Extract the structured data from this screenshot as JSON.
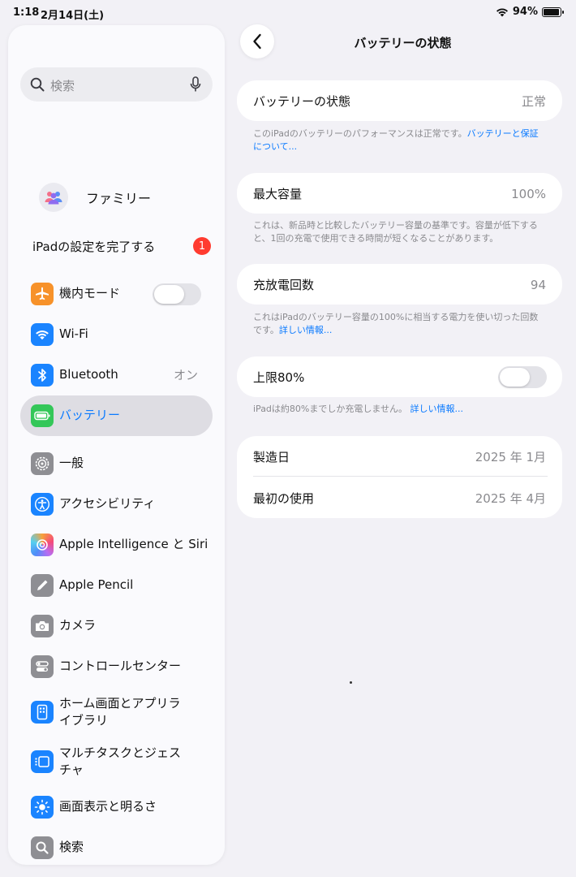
{
  "status_bar": {
    "time": "1:18",
    "date": "2月14日(土)",
    "battery_percent": "94%",
    "battery_level": 0.94
  },
  "sidebar": {
    "search_placeholder": "検索",
    "family_label": "ファミリー",
    "setup_label": "iPadの設定を完了する",
    "setup_badge": "1",
    "items": [
      {
        "label": "機内モード",
        "icon": "airplane-icon",
        "color": "#f7922a",
        "toggle_on": false
      },
      {
        "label": "Wi-Fi",
        "icon": "wifi-icon",
        "color": "#1a84ff"
      },
      {
        "label": "Bluetooth",
        "icon": "bluetooth-icon",
        "color": "#1a84ff",
        "value": "オン"
      },
      {
        "label": "バッテリー",
        "icon": "battery-icon",
        "color": "#34c759",
        "selected": true
      },
      {
        "label": "一般",
        "icon": "gear-icon",
        "color": "#8e8e93"
      },
      {
        "label": "アクセシビリティ",
        "icon": "accessibility-icon",
        "color": "#1a84ff"
      },
      {
        "label": "Apple Intelligence と Siri",
        "icon": "siri-icon",
        "color": "#b86cf2"
      },
      {
        "label": "Apple Pencil",
        "icon": "pencil-icon",
        "color": "#8e8e93"
      },
      {
        "label": "カメラ",
        "icon": "camera-icon",
        "color": "#8e8e93"
      },
      {
        "label": "コントロールセンター",
        "icon": "control-center-icon",
        "color": "#8e8e93"
      },
      {
        "label": "ホーム画面とアプリライブラリ",
        "icon": "home-screen-icon",
        "color": "#1a84ff"
      },
      {
        "label": "マルチタスクとジェスチャ",
        "icon": "multitasking-icon",
        "color": "#1a84ff"
      },
      {
        "label": "画面表示と明るさ",
        "icon": "brightness-icon",
        "color": "#1a84ff"
      },
      {
        "label": "検索",
        "icon": "search-icon",
        "color": "#8e8e93"
      }
    ]
  },
  "detail": {
    "title": "バッテリーの状態",
    "health": {
      "label": "バッテリーの状態",
      "value": "正常"
    },
    "health_note": "このiPadのバッテリーのパフォーマンスは正常です。",
    "health_link": "バッテリーと保証について...",
    "capacity": {
      "label": "最大容量",
      "value": "100%"
    },
    "capacity_note": "これは、新品時と比較したバッテリー容量の基準です。容量が低下すると、1回の充電で使用できる時間が短くなることがあります。",
    "cycles": {
      "label": "充放電回数",
      "value": "94"
    },
    "cycles_note": "これはiPadのバッテリー容量の100%に相当する電力を使い切った回数です。",
    "cycles_link": "詳しい情報...",
    "limit": {
      "label": "上限80%",
      "toggle_on": false
    },
    "limit_note": "iPadは約80%までしか充電しません。",
    "limit_link": "詳しい情報...",
    "manufacture": {
      "label": "製造日",
      "value": "2025 年 1月"
    },
    "first_use": {
      "label": "最初の使用",
      "value": "2025 年 4月"
    }
  }
}
